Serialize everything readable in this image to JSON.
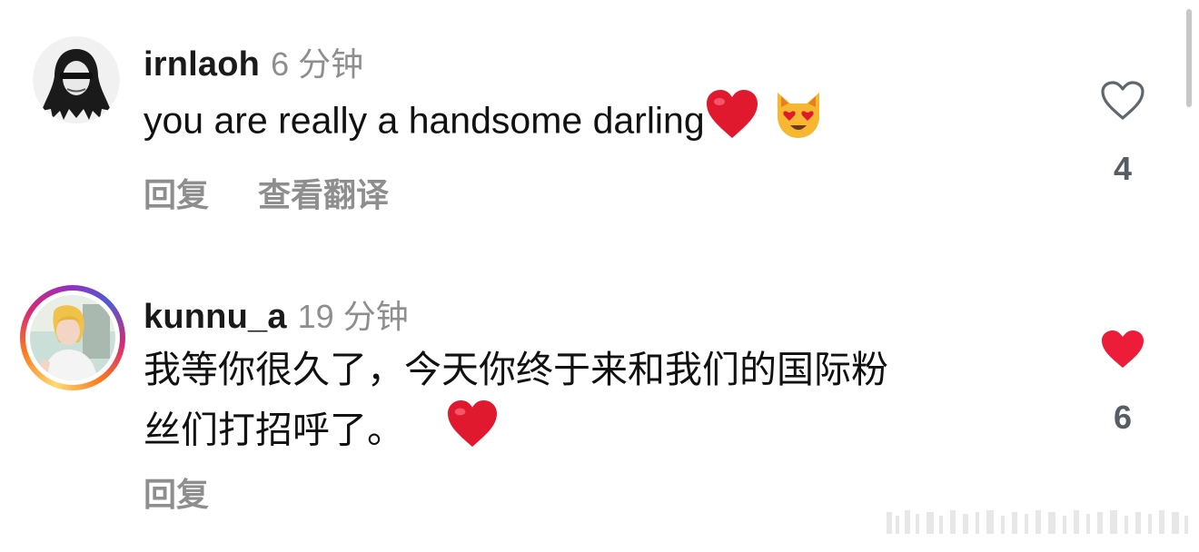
{
  "comments": [
    {
      "username": "irnlaoh",
      "time": "6 分钟",
      "text": "you are really a handsome darling",
      "actions": {
        "reply": "回复",
        "translate": "查看翻译"
      },
      "likes": "4",
      "liked": false,
      "emojis": [
        "red-heart",
        "heart-eyes-cat"
      ]
    },
    {
      "username": "kunnu_a",
      "time": "19 分钟",
      "text_line1": "我等你很久了，今天你终于来和我们的国际粉",
      "text_line2": "丝们打招呼了。",
      "actions": {
        "reply": "回复"
      },
      "likes": "6",
      "liked": true,
      "has_story_ring": true,
      "emojis": [
        "red-heart"
      ]
    }
  ],
  "colors": {
    "like_active": "#ed1d3a",
    "muted_text": "#8e8e8e"
  }
}
